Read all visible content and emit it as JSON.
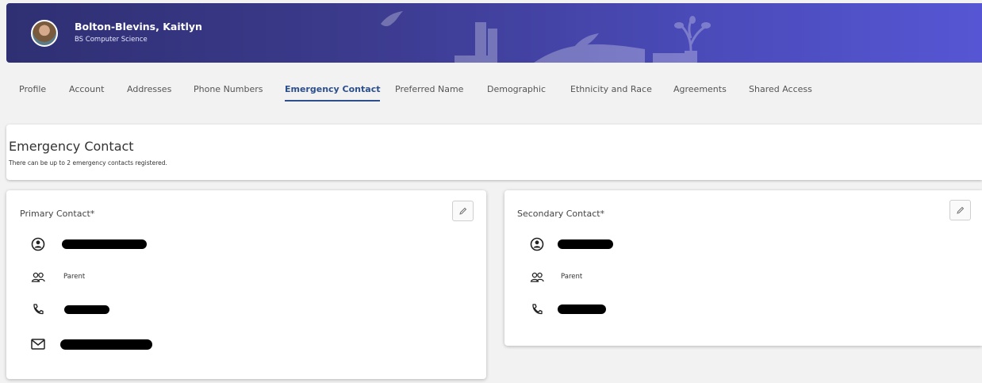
{
  "user": {
    "name": "Bolton-Blevins, Kaitlyn",
    "program": "BS Computer Science"
  },
  "tabs": [
    {
      "label": "Profile"
    },
    {
      "label": "Account"
    },
    {
      "label": "Addresses"
    },
    {
      "label": "Phone Numbers"
    },
    {
      "label": "Emergency Contact"
    },
    {
      "label": "Preferred Name"
    },
    {
      "label": "Demographic"
    },
    {
      "label": "Ethnicity and Race"
    },
    {
      "label": "Agreements"
    },
    {
      "label": "Shared Access"
    }
  ],
  "active_tab": "Emergency Contact",
  "section": {
    "title": "Emergency Contact",
    "subtitle": "There can be up to 2 emergency contacts registered."
  },
  "primary": {
    "title": "Primary Contact*",
    "relationship": "Parent"
  },
  "secondary": {
    "title": "Secondary Contact*",
    "relationship": "Parent"
  },
  "colors": {
    "accent": "#2d4f8a",
    "banner_start": "#2f2f73",
    "banner_end": "#5656d4"
  },
  "icons": [
    "person-icon",
    "people-icon",
    "phone-icon",
    "mail-icon",
    "pencil-icon"
  ]
}
